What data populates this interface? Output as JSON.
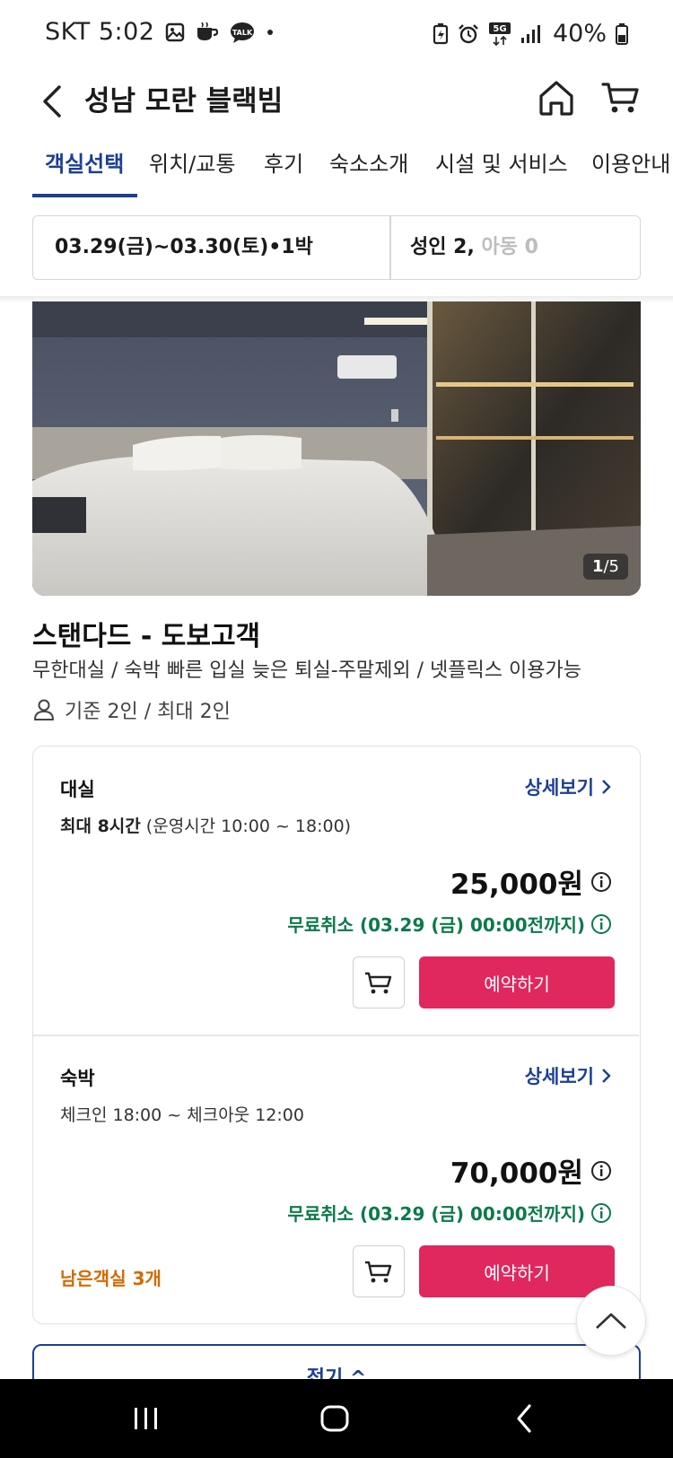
{
  "status_bar": {
    "carrier_time": "SKT 5:02",
    "network": "5G",
    "battery": "40%",
    "icons": [
      "gallery-icon",
      "coffee-icon",
      "talk-icon",
      "dot-icon",
      "battery-saver-icon",
      "alarm-icon",
      "signal-icon",
      "battery-icon"
    ]
  },
  "header": {
    "title": "성남 모란 블랙빔"
  },
  "tabs": [
    {
      "label": "객실선택",
      "active": true
    },
    {
      "label": "위치/교통"
    },
    {
      "label": "후기"
    },
    {
      "label": "숙소소개"
    },
    {
      "label": "시설 및 서비스"
    },
    {
      "label": "이용안내"
    }
  ],
  "search": {
    "dates": "03.29(금)~03.30(토)•1박",
    "adults": "성인 2,",
    "children": " 아동 0"
  },
  "photo": {
    "current": "1",
    "total": "/5"
  },
  "room": {
    "name": "스탠다드 - 도보고객",
    "description": "무한대실 / 숙박 빠른 입실 늦은 퇴실-주말제외 / 넷플릭스 이용가능",
    "capacity": "기준 2인 / 최대 2인"
  },
  "rates": [
    {
      "title": "대실",
      "detail_label": "상세보기",
      "sub_bold": "최대 8시간",
      "sub_rest": " (운영시간 10:00 ~ 18:00)",
      "price": "25,000원",
      "cancel": "무료취소 (03.29 (금) 00:00전까지)",
      "reserve_label": "예약하기",
      "rooms_left": ""
    },
    {
      "title": "숙박",
      "detail_label": "상세보기",
      "sub_bold": "",
      "sub_rest": "체크인 18:00 ~ 체크아웃 12:00",
      "price": "70,000원",
      "cancel": "무료취소 (03.29 (금) 00:00전까지)",
      "reserve_label": "예약하기",
      "rooms_left": "남은객실 3개"
    }
  ],
  "collapse": {
    "label": "접기 ^"
  },
  "colors": {
    "accent": "#1c3f94",
    "reserve": "#e0285f",
    "free_cancel": "#0b7a4a",
    "rooms_left": "#d06b00"
  }
}
